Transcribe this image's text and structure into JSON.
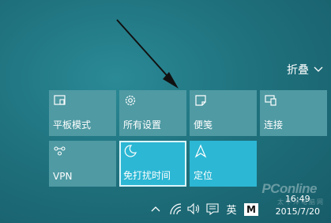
{
  "header": {
    "collapse_label": "折叠"
  },
  "tiles": [
    {
      "label": "平板模式",
      "icon": "tablet-mode-icon",
      "active": false
    },
    {
      "label": "所有设置",
      "icon": "gear-icon",
      "active": false
    },
    {
      "label": "便笺",
      "icon": "note-icon",
      "active": false
    },
    {
      "label": "连接",
      "icon": "connect-icon",
      "active": false
    },
    {
      "label": "VPN",
      "icon": "vpn-icon",
      "active": false
    },
    {
      "label": "免打扰时间",
      "icon": "moon-icon",
      "active": true
    },
    {
      "label": "定位",
      "icon": "location-icon",
      "active": true
    }
  ],
  "taskbar": {
    "ime_label": "英",
    "ime_mode": "M",
    "time": "16:49",
    "date": "2015/7/20"
  },
  "watermark": {
    "brand": "PConline",
    "subtitle": "太平洋电脑网"
  },
  "colors": {
    "tile": "#4f9aa3",
    "tile_active": "#2cb7d4",
    "background": "#1f727e"
  }
}
